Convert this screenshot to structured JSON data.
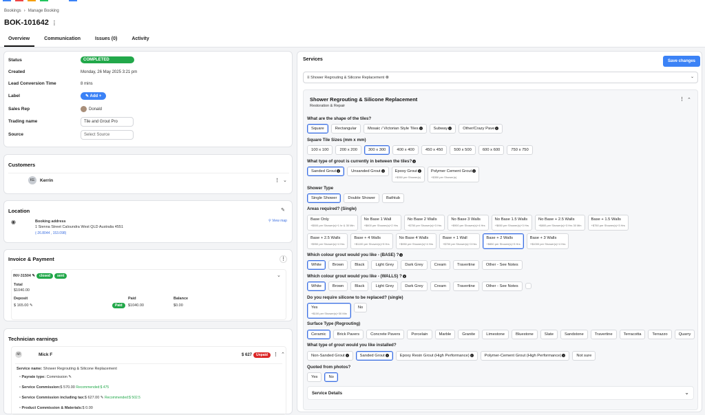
{
  "breadcrumb": {
    "root": "Bookings",
    "current": "Manage Booking"
  },
  "booking_id": "BOK-101642",
  "tabs": [
    "Overview",
    "Communication",
    "Issues (0)",
    "Activity"
  ],
  "overview": {
    "status_label": "Status",
    "status_value": "COMPLETED",
    "created_label": "Created",
    "created_value": "Monday, 26 May 2025 3:21 pm",
    "lead_label": "Lead Conversion Time",
    "lead_value": "8 mins",
    "label_label": "Label",
    "add_label": "Add +",
    "rep_label": "Sales Rep",
    "rep_value": "Donald",
    "trading_label": "Trading name",
    "trading_value": "Tile and Grout Pro",
    "source_label": "Source",
    "source_placeholder": "Select Source"
  },
  "customers": {
    "title": "Customers",
    "initials": "KE",
    "name": "Kerrin"
  },
  "location": {
    "title": "Location",
    "addr_label": "Booking address",
    "address": "1 Sienna Street Caloundra West QLD Australia 4551",
    "coords": "(-26.8044 , 153.098)",
    "view_map": "View map"
  },
  "invoice": {
    "title": "Invoice & Payment",
    "number": "INV-31504",
    "status1": "closed",
    "status2": "sent",
    "total_label": "Total",
    "total_value": "$1040.00",
    "deposit_label": "Deposit",
    "deposit_value": "$ 165.00",
    "paid_badge": "Paid",
    "paid_label": "Paid",
    "paid_value": "$1040.00",
    "balance_label": "Balance",
    "balance_value": "$0.00"
  },
  "technician": {
    "title": "Technician earnings",
    "initials": "MI",
    "name": "Mick F",
    "amount": "$ 627",
    "unpaid": "Unpaid",
    "service_name_label": "Service name:",
    "service_name": "Shower Regrouting & Silicone Replacement",
    "payrate_label": "Payrate type:",
    "payrate": "Commission",
    "commission_label": "Service Commission:",
    "commission": "$ 570.00",
    "commission_rec": "Recommended:$ 475",
    "commission_tax_label": "Service Commission including tax:",
    "commission_tax": "$ 627.00",
    "commission_tax_rec": "Recommended:$ 502.5",
    "product_label": "Product Commission & Materials:",
    "product_value": "$ 0.00"
  },
  "services": {
    "title": "Services",
    "save": "Save changes",
    "selected_tag": "Shower Regrouting & Silicone Replacement",
    "card_title": "Shower Regrouting & Silicone Replacement",
    "card_sub": "Restoration & Repair",
    "q_shape": "What are the shape of the tiles?",
    "shape_opts": [
      "Square",
      "Rectangular",
      "Mosaic / Victorian Style Tiles",
      "Subway",
      "Other/Crazy Pave"
    ],
    "q_sizes": "Square Tile Sizes (mm x mm)",
    "size_opts": [
      "100 x 100",
      "200 x 200",
      "300 x 300",
      "400 x 400",
      "450 x 450",
      "500 x 500",
      "600 x 600",
      "750 x 750"
    ],
    "q_grout_type": "What type of grout is currently in between the tiles?",
    "grout_opts": [
      {
        "label": "Sanded Grout",
        "sub": ""
      },
      {
        "label": "Unsanded Grout",
        "sub": ""
      },
      {
        "label": "Epoxy Grout",
        "sub": "+$350 per Shower(s)"
      },
      {
        "label": "Polymer Cement Grout",
        "sub": "+$350 per Shower(s)"
      }
    ],
    "q_shower": "Shower Type",
    "shower_opts": [
      "Single Shower",
      "Double Shower",
      "Bathtub"
    ],
    "q_areas": "Areas required? (Single)",
    "area_row1": [
      {
        "label": "Base Only",
        "sub": "+$500 per Shower(s)+1 hr & 30 Min"
      },
      {
        "label": "No Base 1 Wall",
        "sub": "+$600 per Shower(s)+2 Hrs"
      },
      {
        "label": "No Base 2 Walls",
        "sub": "+$750 per Shower(s)+3 Hrs"
      },
      {
        "label": "No Base 3 Walls",
        "sub": "+$900 per Shower(s)+4 Hrs"
      },
      {
        "label": "No Base 1.5 Walls",
        "sub": "+$650 per Shower(s)+3 Hrs"
      },
      {
        "label": "No Base + 2.5 Walls",
        "sub": "+$800 per Shower(s)+3 Hrs 30 Min"
      },
      {
        "label": "Base + 1.5 Walls",
        "sub": "+$750 per Shower(s)+3 Hrs"
      }
    ],
    "area_row2": [
      {
        "label": "Base + 2.5 Walls",
        "sub": "+$950 per Shower(s)+4 Hrs"
      },
      {
        "label": "Base + 4 Walls",
        "sub": "+$1100 per Shower(s)+5 Hrs"
      },
      {
        "label": "No Base 4 Walls",
        "sub": "+$950 per Shower(s)+4 Hrs"
      },
      {
        "label": "Base + 1 Wall",
        "sub": "+$700 per Shower(s)+3 Hrs"
      },
      {
        "label": "Base + 2 Walls",
        "sub": "+$850 per Shower(s)+3 Hrs"
      },
      {
        "label": "Base + 3 Walls",
        "sub": "+$1000 per Shower(s)+4 Hrs"
      }
    ],
    "q_colour_base": "Which colour grout would you like - (BASE) ?",
    "q_colour_walls": "Which colour grout would you like - (WALLS) ?",
    "colour_opts": [
      "White",
      "Brown",
      "Black",
      "Light Grey",
      "Dark Grey",
      "Cream",
      "Travertine",
      "Other - See Notes"
    ],
    "q_silicone": "Do you require silicone to be replaced? (single)",
    "silicone_yes": "Yes",
    "silicone_yes_sub": "+$100 per Shower(s)+30 Min",
    "silicone_no": "No",
    "q_surface": "Surface Type (Regrouting)",
    "surface_opts": [
      "Ceramic",
      "Brick Pavers",
      "Concrete Pavers",
      "Porcelain",
      "Marble",
      "Granite",
      "Limestone",
      "Bluestone",
      "Slate",
      "Sandstone",
      "Travertine",
      "Terracotta",
      "Terrazzo",
      "Quarry"
    ],
    "q_install": "What type of grout would you like installed?",
    "install_opts": [
      "Non-Sanded Grout",
      "Sanded Grout",
      "Epoxy Resin Grout (High Performance)",
      "Polymer-Cement Grout (High Performance)",
      "Not sure"
    ],
    "q_quoted": "Quoted from photos?",
    "quoted_opts": [
      "Yes",
      "No"
    ],
    "service_details": "Service Details"
  }
}
